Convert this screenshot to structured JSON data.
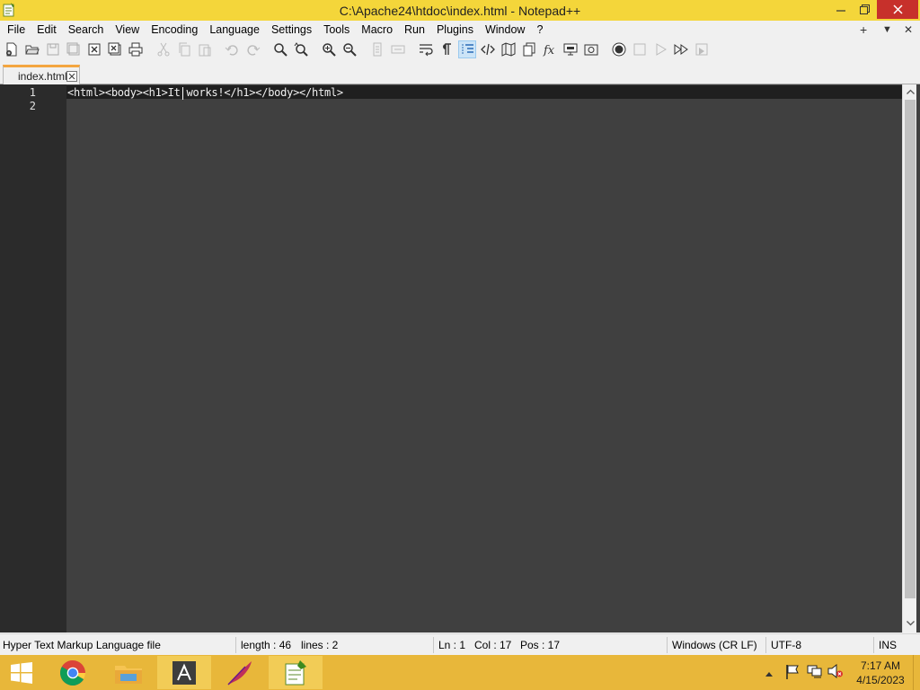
{
  "window": {
    "title": "C:\\Apache24\\htdoc\\index.html - Notepad++"
  },
  "menu": {
    "items": [
      "File",
      "Edit",
      "Search",
      "View",
      "Encoding",
      "Language",
      "Settings",
      "Tools",
      "Macro",
      "Run",
      "Plugins",
      "Window",
      "?"
    ],
    "right_controls": [
      "+",
      "▼",
      "✕"
    ]
  },
  "toolbar": {
    "icons": [
      "new-file-icon",
      "open-file-icon",
      "save-icon",
      "save-all-icon",
      "close-icon",
      "close-all-icon",
      "print-icon",
      "cut-icon",
      "copy-icon",
      "paste-icon",
      "undo-icon",
      "redo-icon",
      "find-icon",
      "replace-icon",
      "zoom-in-icon",
      "zoom-out-icon",
      "sync-vertical-icon",
      "sync-horizontal-icon",
      "word-wrap-icon",
      "show-all-chars-icon",
      "indent-guide-icon",
      "xml-tag-icon",
      "document-map-icon",
      "document-list-icon",
      "function-list-icon",
      "monitor-icon",
      "folder-workspace-icon",
      "record-macro-icon",
      "stop-record-icon",
      "play-macro-icon",
      "run-macro-multiple-icon",
      "save-macro-icon"
    ],
    "active": "indent-guide-icon"
  },
  "tabs": [
    {
      "label": "index.html",
      "active": true
    }
  ],
  "editor": {
    "lines": [
      {
        "number": "1",
        "text": "<html><body><h1>It works!</h1></body></html>"
      },
      {
        "number": "2",
        "text": ""
      }
    ],
    "background": "#404040",
    "gutter_background": "#2b2b2b",
    "current_line_background": "#1f1f1f",
    "text_color": "#f0f0f0"
  },
  "statusbar": {
    "file_type": "Hyper Text Markup Language file",
    "length": "length : 46",
    "lines": "lines : 2",
    "ln": "Ln : 1",
    "col": "Col : 17",
    "pos": "Pos : 17",
    "eol": "Windows (CR LF)",
    "encoding": "UTF-8",
    "mode": "INS"
  },
  "taskbar": {
    "apps": [
      "start-icon",
      "chrome-icon",
      "file-explorer-icon",
      "adobe-icon",
      "feather-icon",
      "notepadpp-icon"
    ],
    "clock_time": "7:17 AM",
    "clock_date": "4/15/2023",
    "accent": "#e8b73a"
  },
  "colors": {
    "titlebar": "#f4d63a",
    "close_button": "#c7302b",
    "tab_accent": "#f4a640"
  }
}
